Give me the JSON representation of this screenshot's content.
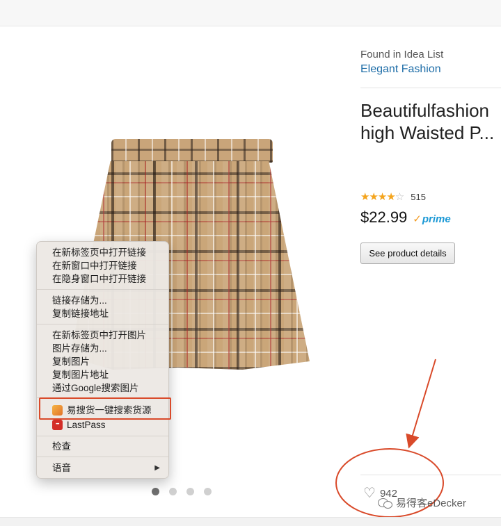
{
  "sidebar": {
    "found_label": "Found in Idea List",
    "idea_list_name": "Elegant Fashion"
  },
  "product": {
    "title_line1": "Beautifulfashion",
    "title_line2": "high Waisted P...",
    "rating_count": "515",
    "price": "$22.99",
    "prime_label": "prime",
    "details_button": "See product details",
    "like_count": "942",
    "rating_stars": 4
  },
  "gallery": {
    "dot_count": 4,
    "active_dot": 0
  },
  "context_menu": {
    "items": [
      "在新标签页中打开链接",
      "在新窗口中打开链接",
      "在隐身窗口中打开链接",
      "链接存储为...",
      "复制链接地址",
      "在新标签页中打开图片",
      "图片存储为...",
      "复制图片",
      "复制图片地址",
      "通过Google搜索图片",
      "易搜货一键搜索货源",
      "LastPass",
      "检查",
      "语音"
    ],
    "lastpass_icon_text": "•••",
    "submenu_arrow": "▶"
  },
  "watermark": {
    "text": "易得客eDecker"
  },
  "colors": {
    "annotation_red": "#d94a2a",
    "link_blue": "#1f6ea8",
    "star_orange": "#f4a41c",
    "prime_blue": "#1a98d5"
  }
}
